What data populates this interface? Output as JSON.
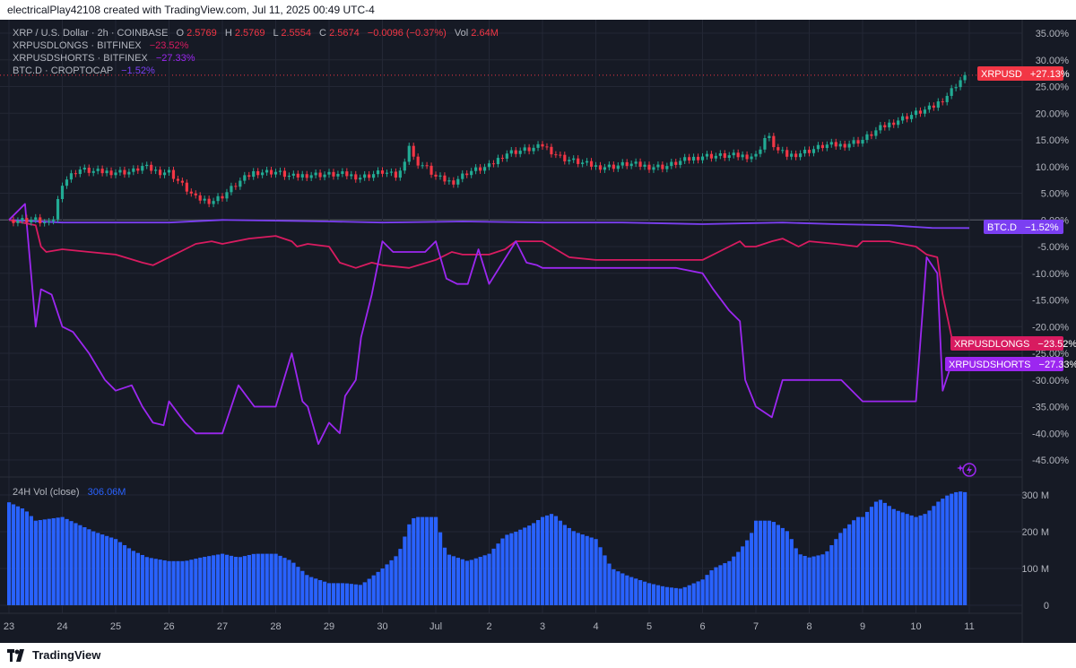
{
  "header": {
    "created_by": "electricalPlay42108 created with TradingView.com, Jul 11, 2025 00:49 UTC-4"
  },
  "legend": {
    "main": {
      "symbol": "XRP / U.S. Dollar · 2h · COINBASE",
      "o_label": "O",
      "o": "2.5769",
      "h_label": "H",
      "h": "2.5769",
      "l_label": "L",
      "l": "2.5554",
      "c_label": "C",
      "c": "2.5674",
      "chg": "−0.0096 (−0.37%)",
      "vol_label": "Vol",
      "vol": "2.64M"
    },
    "longs": {
      "name": "XRPUSDLONGS · BITFINEX",
      "value": "−23.52%"
    },
    "shorts": {
      "name": "XRPUSDSHORTS · BITFINEX",
      "value": "−27.33%"
    },
    "btcd": {
      "name": "BTC.D · CROPTOCAP",
      "value": "−1.52%"
    },
    "volume": {
      "name": "24H Vol (close)",
      "value": "306.06M"
    }
  },
  "badges": {
    "xrp": {
      "name": "XRPUSD",
      "value": "+27.13%"
    },
    "btcd": {
      "name": "BTC.D",
      "value": "−1.52%"
    },
    "longs": {
      "name": "XRPUSDLONGS",
      "value": "−23.52%"
    },
    "shorts": {
      "name": "XRPUSDSHORTS",
      "value": "−27.33%"
    }
  },
  "brand": {
    "name": "TradingView"
  },
  "colors": {
    "background": "#161a25",
    "grid": "#232735",
    "up": "#22ab94",
    "down": "#f23645",
    "longs": "#d81b60",
    "shorts": "#9c27f0",
    "btcd": "#7b3ff2",
    "volume": "#2962ff",
    "axis_text": "#b2b5be"
  },
  "chart_data": [
    {
      "type": "line",
      "title": "XRP / U.S. Dollar · 2h · COINBASE",
      "y_unit": "% change",
      "ylim": [
        -48,
        36
      ],
      "y_ticks": [
        "35.00%",
        "30.00%",
        "25.00%",
        "20.00%",
        "15.00%",
        "10.00%",
        "5.00%",
        "0.00%",
        "-5.00%",
        "-10.00%",
        "-15.00%",
        "-20.00%",
        "-25.00%",
        "-30.00%",
        "-35.00%",
        "-40.00%",
        "-45.00%"
      ],
      "x_ticks": [
        "23",
        "24",
        "25",
        "26",
        "27",
        "28",
        "29",
        "30",
        "Jul",
        "2",
        "3",
        "4",
        "5",
        "6",
        "7",
        "8",
        "9",
        "10",
        "11"
      ],
      "grid": true,
      "series": [
        {
          "name": "XRPUSD",
          "style": "candles",
          "x": [
            23.0,
            23.5,
            23.8,
            24.0,
            24.3,
            24.6,
            25.0,
            25.3,
            25.5,
            25.8,
            26.0,
            26.3,
            26.5,
            26.8,
            27.0,
            27.3,
            27.6,
            28.0,
            28.3,
            28.6,
            29.0,
            29.3,
            29.6,
            30.0,
            30.3,
            30.5,
            30.6,
            30.8,
            31.0,
            31.3,
            31.6,
            32.0,
            32.3,
            32.6,
            32.9,
            33.0,
            33.3,
            33.4,
            33.6,
            34.0,
            34.3,
            34.6,
            35.0,
            35.3,
            35.6,
            36.0,
            36.3,
            36.6,
            37.0,
            37.2,
            37.4,
            37.6,
            38.0,
            38.3,
            38.6,
            39.0,
            39.3,
            39.6,
            40.0,
            40.3,
            40.6,
            40.8,
            41.0
          ],
          "y": [
            0.0,
            0.0,
            -1.0,
            7.0,
            9.5,
            9.0,
            9.0,
            9.0,
            10.0,
            9.0,
            9.0,
            6.0,
            4.0,
            3.5,
            4.5,
            7.0,
            9.0,
            9.0,
            8.0,
            8.5,
            8.5,
            8.5,
            8.0,
            9.0,
            8.0,
            14.0,
            11.0,
            10.0,
            8.0,
            7.0,
            9.0,
            10.0,
            12.5,
            13.0,
            13.5,
            14.0,
            12.0,
            11.5,
            11.0,
            10.0,
            10.0,
            10.5,
            10.0,
            10.0,
            11.0,
            12.0,
            12.0,
            12.0,
            12.0,
            16.0,
            13.0,
            12.0,
            13.0,
            14.0,
            14.0,
            15.0,
            17.0,
            18.5,
            20.0,
            21.0,
            23.5,
            26.0,
            27.13
          ]
        },
        {
          "name": "BTC.D",
          "style": "line",
          "x": [
            23.0,
            24.0,
            26.0,
            27.0,
            29.0,
            30.0,
            31.5,
            33.0,
            34.5,
            36.0,
            37.5,
            38.5,
            39.5,
            40.3,
            41.0
          ],
          "y": [
            0.0,
            -0.5,
            -0.5,
            0.0,
            -0.3,
            -0.5,
            -0.3,
            -0.5,
            -0.5,
            -0.8,
            -0.5,
            -0.8,
            -1.0,
            -1.5,
            -1.52
          ]
        },
        {
          "name": "XRPUSDLONGS",
          "style": "line",
          "x": [
            23.0,
            23.5,
            23.6,
            23.7,
            24.0,
            24.5,
            25.0,
            25.5,
            25.7,
            26.0,
            26.3,
            26.5,
            26.8,
            27.0,
            27.5,
            28.0,
            28.3,
            28.4,
            28.6,
            29.0,
            29.2,
            29.5,
            29.8,
            30.0,
            30.5,
            31.0,
            31.3,
            31.5,
            31.8,
            32.0,
            32.3,
            32.5,
            32.7,
            33.0,
            33.5,
            34.0,
            34.5,
            35.0,
            35.5,
            36.0,
            36.5,
            36.7,
            36.8,
            37.0,
            37.3,
            37.5,
            37.8,
            38.0,
            38.5,
            38.9,
            39.0,
            39.5,
            40.0,
            40.2,
            40.4,
            40.5,
            40.7,
            41.0
          ],
          "y": [
            0.0,
            -1.0,
            -5.0,
            -6.0,
            -5.5,
            -6.0,
            -6.5,
            -8.0,
            -8.5,
            -7.0,
            -5.5,
            -4.5,
            -4.0,
            -4.5,
            -3.5,
            -3.0,
            -4.0,
            -5.0,
            -4.5,
            -5.0,
            -8.0,
            -9.0,
            -8.0,
            -8.5,
            -9.0,
            -7.5,
            -6.0,
            -6.5,
            -6.5,
            -6.5,
            -5.5,
            -4.0,
            -4.0,
            -4.0,
            -7.0,
            -7.5,
            -7.5,
            -7.5,
            -7.5,
            -7.5,
            -5.0,
            -4.0,
            -5.0,
            -5.0,
            -4.0,
            -3.5,
            -5.0,
            -4.0,
            -4.5,
            -5.0,
            -4.0,
            -4.0,
            -5.0,
            -6.5,
            -7.0,
            -14.0,
            -23.5,
            -23.52
          ]
        },
        {
          "name": "XRPUSDSHORTS",
          "style": "line",
          "x": [
            23.0,
            23.3,
            23.5,
            23.6,
            23.8,
            24.0,
            24.2,
            24.5,
            24.8,
            25.0,
            25.3,
            25.5,
            25.7,
            25.9,
            26.0,
            26.3,
            26.5,
            26.8,
            27.0,
            27.3,
            27.6,
            28.0,
            28.3,
            28.5,
            28.6,
            28.8,
            29.0,
            29.2,
            29.3,
            29.5,
            29.6,
            29.8,
            30.0,
            30.2,
            30.4,
            30.6,
            30.8,
            31.0,
            31.2,
            31.4,
            31.6,
            31.8,
            32.0,
            32.5,
            32.7,
            32.9,
            33.0,
            33.2,
            33.3,
            33.5,
            33.6,
            34.0,
            34.5,
            35.0,
            35.5,
            36.0,
            36.2,
            36.5,
            36.7,
            36.8,
            37.0,
            37.3,
            37.5,
            37.8,
            38.0,
            38.3,
            38.6,
            39.0,
            39.3,
            39.5,
            40.0,
            40.2,
            40.4,
            40.5,
            40.7,
            41.0
          ],
          "y": [
            0.0,
            3.0,
            -20.0,
            -13.0,
            -14.0,
            -20.0,
            -21.0,
            -25.0,
            -30.0,
            -32.0,
            -31.0,
            -35.0,
            -38.0,
            -38.5,
            -34.0,
            -38.0,
            -40.0,
            -40.0,
            -40.0,
            -31.0,
            -35.0,
            -35.0,
            -25.0,
            -34.0,
            -35.0,
            -42.0,
            -38.0,
            -40.0,
            -33.0,
            -30.0,
            -22.0,
            -14.0,
            -4.0,
            -6.0,
            -6.0,
            -6.0,
            -6.0,
            -4.0,
            -11.0,
            -12.0,
            -12.0,
            -5.5,
            -12.0,
            -4.0,
            -8.0,
            -8.5,
            -9.0,
            -9.0,
            -9.0,
            -9.0,
            -9.0,
            -9.0,
            -9.0,
            -9.0,
            -9.0,
            -10.0,
            -13.0,
            -17.0,
            -19.0,
            -30.0,
            -35.0,
            -37.0,
            -30.0,
            -30.0,
            -30.0,
            -30.0,
            -30.0,
            -34.0,
            -34.0,
            -34.0,
            -34.0,
            -7.0,
            -10.0,
            -32.0,
            -26.0,
            -27.33
          ]
        }
      ]
    },
    {
      "type": "bar",
      "title": "24H Vol (close)",
      "ylim": [
        0,
        320
      ],
      "y_ticks": [
        "300 M",
        "200 M",
        "100 M",
        "0"
      ],
      "y_unit": "M",
      "x_range": [
        23,
        41
      ],
      "series": [
        {
          "name": "24H Vol (close)",
          "x": [
            23.0,
            23.3,
            23.5,
            24.0,
            24.3,
            24.6,
            25.0,
            25.3,
            25.6,
            26.0,
            26.3,
            26.6,
            27.0,
            27.3,
            27.6,
            28.0,
            28.3,
            28.6,
            29.0,
            29.3,
            29.6,
            30.0,
            30.3,
            30.5,
            30.6,
            31.0,
            31.2,
            31.4,
            31.6,
            32.0,
            32.3,
            32.5,
            32.8,
            33.0,
            33.2,
            33.4,
            33.6,
            34.0,
            34.3,
            34.6,
            35.0,
            35.3,
            35.6,
            36.0,
            36.2,
            36.5,
            36.7,
            36.9,
            37.0,
            37.3,
            37.6,
            37.8,
            38.0,
            38.3,
            38.6,
            38.9,
            39.0,
            39.3,
            39.6,
            40.0,
            40.2,
            40.4,
            40.6,
            40.8,
            41.0
          ],
          "y": [
            280,
            260,
            230,
            240,
            220,
            200,
            180,
            150,
            130,
            120,
            120,
            130,
            140,
            130,
            140,
            140,
            120,
            80,
            60,
            60,
            55,
            100,
            140,
            220,
            240,
            240,
            140,
            130,
            120,
            140,
            190,
            200,
            220,
            240,
            250,
            220,
            200,
            180,
            100,
            80,
            60,
            50,
            45,
            70,
            100,
            120,
            150,
            190,
            230,
            230,
            200,
            140,
            130,
            140,
            200,
            240,
            240,
            290,
            260,
            240,
            250,
            280,
            300,
            310,
            306
          ]
        }
      ]
    }
  ]
}
